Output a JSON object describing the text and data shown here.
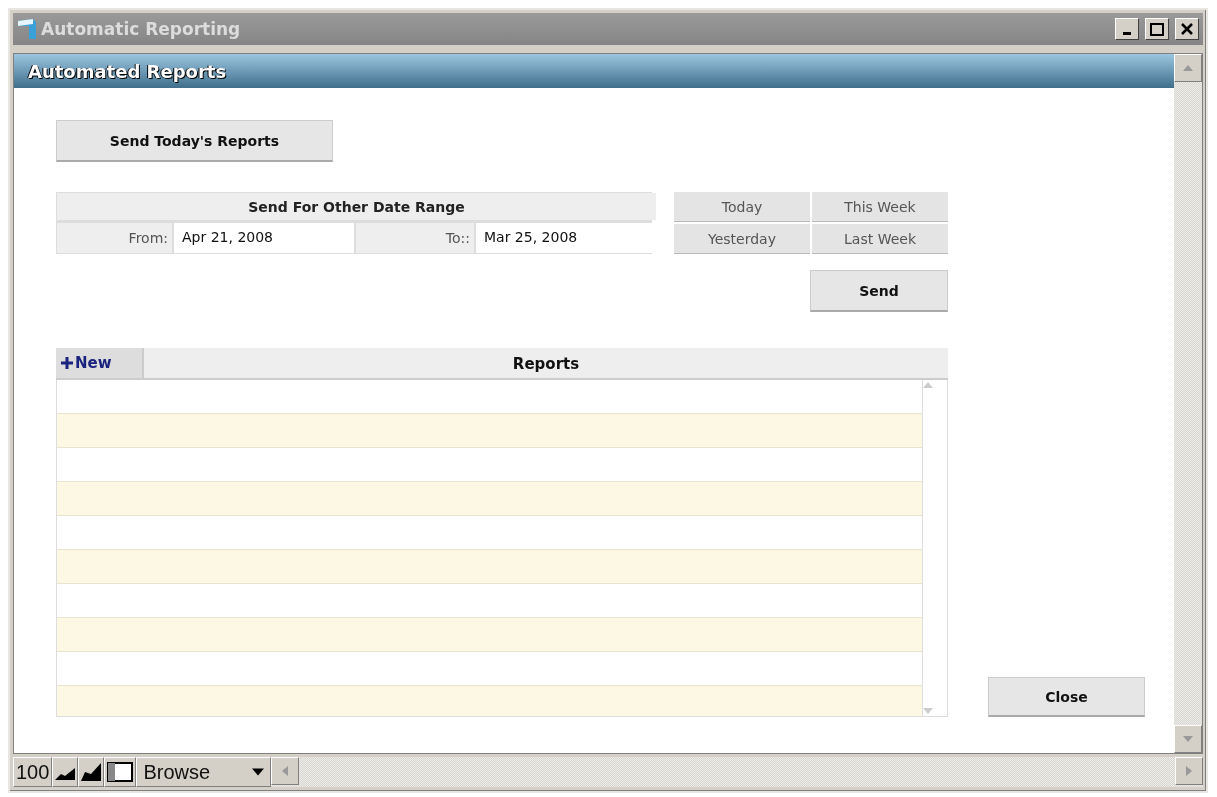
{
  "window": {
    "title": "Automatic Reporting"
  },
  "header": {
    "title": "Automated Reports"
  },
  "send_today_button": "Send Today's Reports",
  "date_range": {
    "title": "Send For Other Date Range",
    "from_label": "From:",
    "from_value": "Apr 21, 2008",
    "to_label": "To::",
    "to_value": "Mar 25, 2008"
  },
  "quick_ranges": [
    "Today",
    "This Week",
    "Yesterday",
    "Last Week"
  ],
  "send_button": "Send",
  "reports": {
    "new_button": "New",
    "title": "Reports"
  },
  "close_button": "Close",
  "status_bar": {
    "zoom": "100",
    "mode": "Browse"
  }
}
